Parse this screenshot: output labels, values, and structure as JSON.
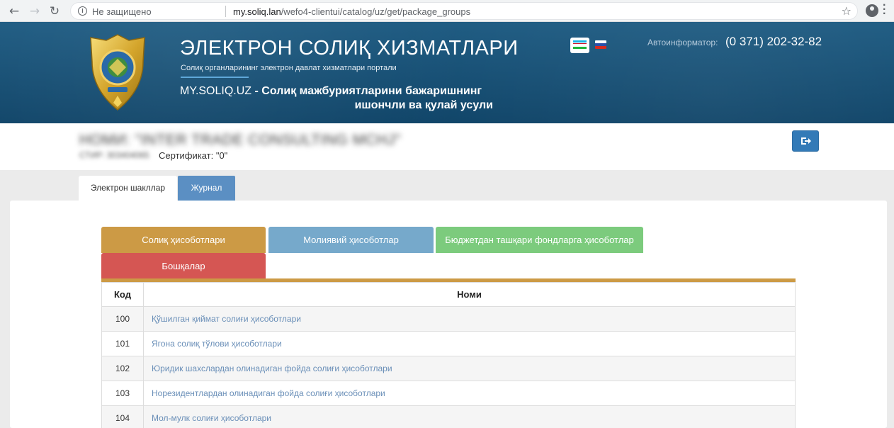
{
  "browser": {
    "insecure_label": "Не защищено",
    "url_host": "my.soliq.lan",
    "url_path": "/wefo4-clientui/catalog/uz/get/package_groups"
  },
  "header": {
    "title": "ЭЛЕКТРОН СОЛИҚ ХИЗМАТЛАРИ",
    "subtitle": "Солиқ органларининг электрон давлат хизматлари портали",
    "slogan_domain": "MY.SOLIQ.UZ",
    "slogan_line1": " - Солиқ мажбуриятларини бажаришнинг",
    "slogan_line2": "ишончли ва қулай усули",
    "informer_label": "Автоинформатор:",
    "phone": "(0 371) 202-32-82",
    "languages": [
      "uz",
      "ru"
    ],
    "colors": {
      "header_bg": "#1b4f72"
    }
  },
  "user": {
    "org_name": "НОМИ: \"INTER TRADE CONSULTING MCHJ\"",
    "stir": "СТИР: 303404065",
    "certificate": "Сертификат: \"0\""
  },
  "tabs": [
    {
      "label": "Электрон шакллар",
      "active": true
    },
    {
      "label": "Журнал",
      "active": false
    }
  ],
  "categories": [
    {
      "label": "Солиқ ҳисоботлари",
      "color": "#cc9a45",
      "active": true
    },
    {
      "label": "Молиявий ҳисоботлар",
      "color": "#76a9cb",
      "active": false
    },
    {
      "label": "Бюджетдан ташқари фондларга ҳисоботлар",
      "color": "#7ccb7d",
      "active": false
    },
    {
      "label": "Бошқалар",
      "color": "#d55653",
      "active": false
    }
  ],
  "table": {
    "columns": [
      "Код",
      "Номи"
    ],
    "rows": [
      {
        "code": "100",
        "name": "Қўшилган қиймат солиғи ҳисоботлари"
      },
      {
        "code": "101",
        "name": "Ягона солиқ тўлови ҳисоботлари"
      },
      {
        "code": "102",
        "name": "Юридик шахслардан олинадиган фойда солиғи ҳисоботлари"
      },
      {
        "code": "103",
        "name": "Норезидентлардан олинадиган фойда солиғи ҳисоботлари"
      },
      {
        "code": "104",
        "name": "Мол-мулк солиғи ҳисоботлари"
      }
    ]
  }
}
